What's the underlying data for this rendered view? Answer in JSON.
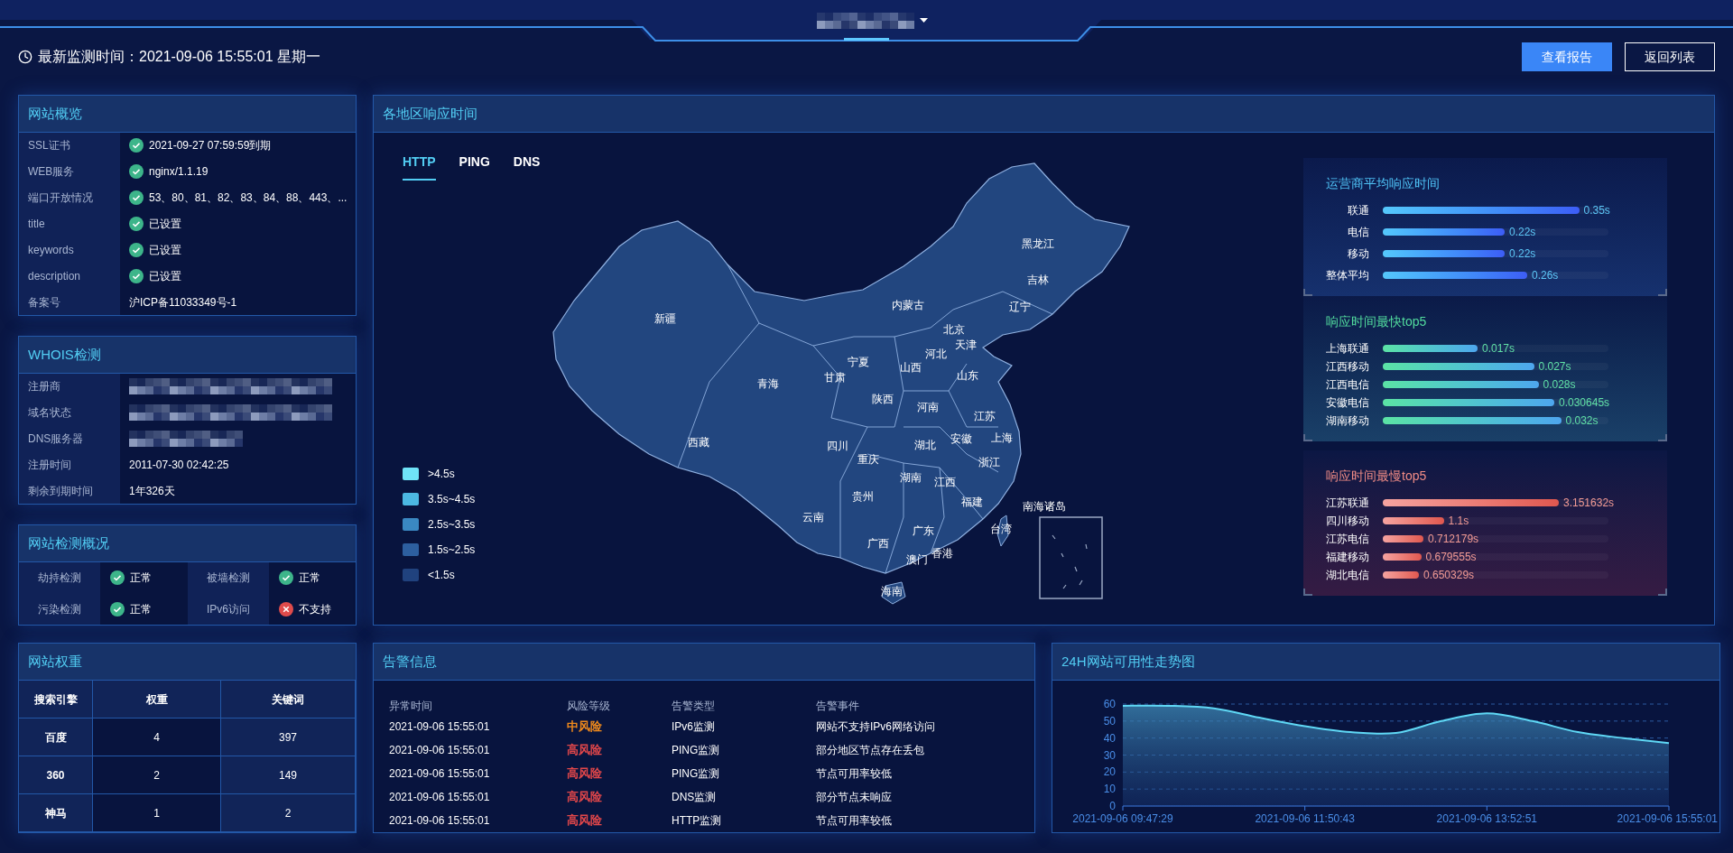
{
  "header": {
    "title_redacted": true,
    "monitor_time": "最新监测时间：2021-09-06 15:55:01 星期一",
    "buttons": [
      {
        "label": "查看报告",
        "kind": "primary"
      },
      {
        "label": "返回列表",
        "kind": "outline"
      }
    ]
  },
  "overview": {
    "title": "网站概览",
    "rows": [
      {
        "label": "SSL证书",
        "kind": "checked",
        "value": "2021-09-27 07:59:59到期"
      },
      {
        "label": "WEB服务",
        "kind": "checked",
        "value": "nginx/1.1.19"
      },
      {
        "label": "端口开放情况",
        "kind": "checked",
        "value": "53、80、81、82、83、84、88、443、..."
      },
      {
        "label": "title",
        "kind": "checked",
        "value": "已设置"
      },
      {
        "label": "keywords",
        "kind": "checked",
        "value": "已设置"
      },
      {
        "label": "description",
        "kind": "checked",
        "value": "已设置"
      },
      {
        "label": "备案号",
        "kind": "plain",
        "value": "沪ICP备11033349号-1"
      }
    ]
  },
  "whois": {
    "title": "WHOIS检测",
    "rows": [
      {
        "label": "注册商",
        "redacted": true
      },
      {
        "label": "域名状态",
        "redacted": true
      },
      {
        "label": "DNS服务器",
        "redacted": true
      },
      {
        "label": "注册时间",
        "redacted": false,
        "value": "2011-07-30 02:42:25"
      },
      {
        "label": "剩余到期时间",
        "redacted": false,
        "value": "1年326天"
      }
    ]
  },
  "checks": {
    "title": "网站检测概况",
    "items": [
      {
        "label": "劫持检测",
        "passed": true,
        "value": "正常"
      },
      {
        "label": "被墙检测",
        "passed": true,
        "value": "正常"
      },
      {
        "label": "污染检测",
        "passed": true,
        "value": "正常"
      },
      {
        "label": "IPv6访问",
        "passed": false,
        "value": "不支持"
      }
    ]
  },
  "weights": {
    "title": "网站权重",
    "columns": [
      "搜索引擎",
      "权重",
      "关键词"
    ],
    "rows": [
      [
        "百度",
        "4",
        "397"
      ],
      [
        "360",
        "2",
        "149"
      ],
      [
        "神马",
        "1",
        "2"
      ]
    ]
  },
  "response_map": {
    "title": "各地区响应时间",
    "tabs": [
      {
        "label": "HTTP",
        "selected": true
      },
      {
        "label": "PING",
        "selected": false
      },
      {
        "label": "DNS",
        "selected": false
      }
    ],
    "legend": [
      {
        "label": ">4.5s",
        "color": "#6fe3f7"
      },
      {
        "label": "3.5s~4.5s",
        "color": "#4cb8e2"
      },
      {
        "label": "2.5s~3.5s",
        "color": "#3a88c2"
      },
      {
        "label": "1.5s~2.5s",
        "color": "#2d5f9f"
      },
      {
        "label": "<1.5s",
        "color": "#20427e"
      }
    ],
    "regions": [
      "黑龙江",
      "吉林",
      "内蒙古",
      "辽宁",
      "新疆",
      "北京",
      "宁夏",
      "河北",
      "天津",
      "青海",
      "甘肃",
      "山西",
      "山东",
      "陕西",
      "河南",
      "江苏",
      "西藏",
      "四川",
      "湖北",
      "安徽",
      "上海",
      "重庆",
      "浙江",
      "湖南",
      "江西",
      "贵州",
      "福建",
      "云南",
      "南海诸岛",
      "广西",
      "广东",
      "台湾",
      "澳门",
      "香港",
      "海南"
    ],
    "bar_groups": [
      {
        "title": "运营商平均响应时间",
        "kind": "average",
        "items": [
          {
            "name": "联通",
            "value": "0.35s",
            "level": 0.87
          },
          {
            "name": "电信",
            "value": "0.22s",
            "level": 0.54
          },
          {
            "name": "移动",
            "value": "0.22s",
            "level": 0.54
          },
          {
            "name": "整体平均",
            "value": "0.26s",
            "level": 0.64
          }
        ]
      },
      {
        "title": "响应时间最快top5",
        "kind": "fast",
        "items": [
          {
            "name": "上海联通",
            "value": "0.017s",
            "level": 0.42
          },
          {
            "name": "江西移动",
            "value": "0.027s",
            "level": 0.67
          },
          {
            "name": "江西电信",
            "value": "0.028s",
            "level": 0.69
          },
          {
            "name": "安徽电信",
            "value": "0.030645s",
            "level": 0.76
          },
          {
            "name": "湖南移动",
            "value": "0.032s",
            "level": 0.79
          }
        ]
      },
      {
        "title": "响应时间最慢top5",
        "kind": "slow",
        "items": [
          {
            "name": "江苏联通",
            "value": "3.151632s",
            "level": 0.78
          },
          {
            "name": "四川移动",
            "value": "1.1s",
            "level": 0.27
          },
          {
            "name": "江苏电信",
            "value": "0.712179s",
            "level": 0.18
          },
          {
            "name": "福建移动",
            "value": "0.679555s",
            "level": 0.17
          },
          {
            "name": "湖北电信",
            "value": "0.650329s",
            "level": 0.16
          }
        ]
      }
    ]
  },
  "alerts": {
    "title": "告警信息",
    "columns": [
      "异常时间",
      "风险等级",
      "告警类型",
      "告警事件"
    ],
    "rows": [
      {
        "time": "2021-09-06 15:55:01",
        "risk": "中风险",
        "color": "#f08a1c",
        "type": "IPv6监测",
        "event": "网站不支持IPv6网络访问"
      },
      {
        "time": "2021-09-06 15:55:01",
        "risk": "高风险",
        "color": "#e2474a",
        "type": "PING监测",
        "event": "部分地区节点存在丢包"
      },
      {
        "time": "2021-09-06 15:55:01",
        "risk": "高风险",
        "color": "#e2474a",
        "type": "PING监测",
        "event": "节点可用率较低"
      },
      {
        "time": "2021-09-06 15:55:01",
        "risk": "高风险",
        "color": "#e2474a",
        "type": "DNS监测",
        "event": "部分节点未响应"
      },
      {
        "time": "2021-09-06 15:55:01",
        "risk": "高风险",
        "color": "#e2474a",
        "type": "HTTP监测",
        "event": "节点可用率较低"
      }
    ]
  },
  "availability": {
    "title": "24H网站可用性走势图",
    "chart_data": {
      "type": "area",
      "categories": [
        "2021-09-06 09:47:29",
        null,
        null,
        null,
        "2021-09-06 11:50:43",
        null,
        null,
        null,
        "2021-09-06 13:52:51",
        null,
        null,
        null,
        "2021-09-06 15:55:01"
      ],
      "series": [
        {
          "color": "#5fd8f5",
          "values": [
            59,
            59,
            57.5,
            52,
            47,
            43.5,
            43,
            50,
            54.5,
            50,
            43.5,
            40,
            37
          ]
        }
      ],
      "ylim": [
        0,
        60
      ],
      "yticks": [
        0,
        10,
        20,
        30,
        40,
        50,
        60
      ],
      "grid": true
    }
  }
}
